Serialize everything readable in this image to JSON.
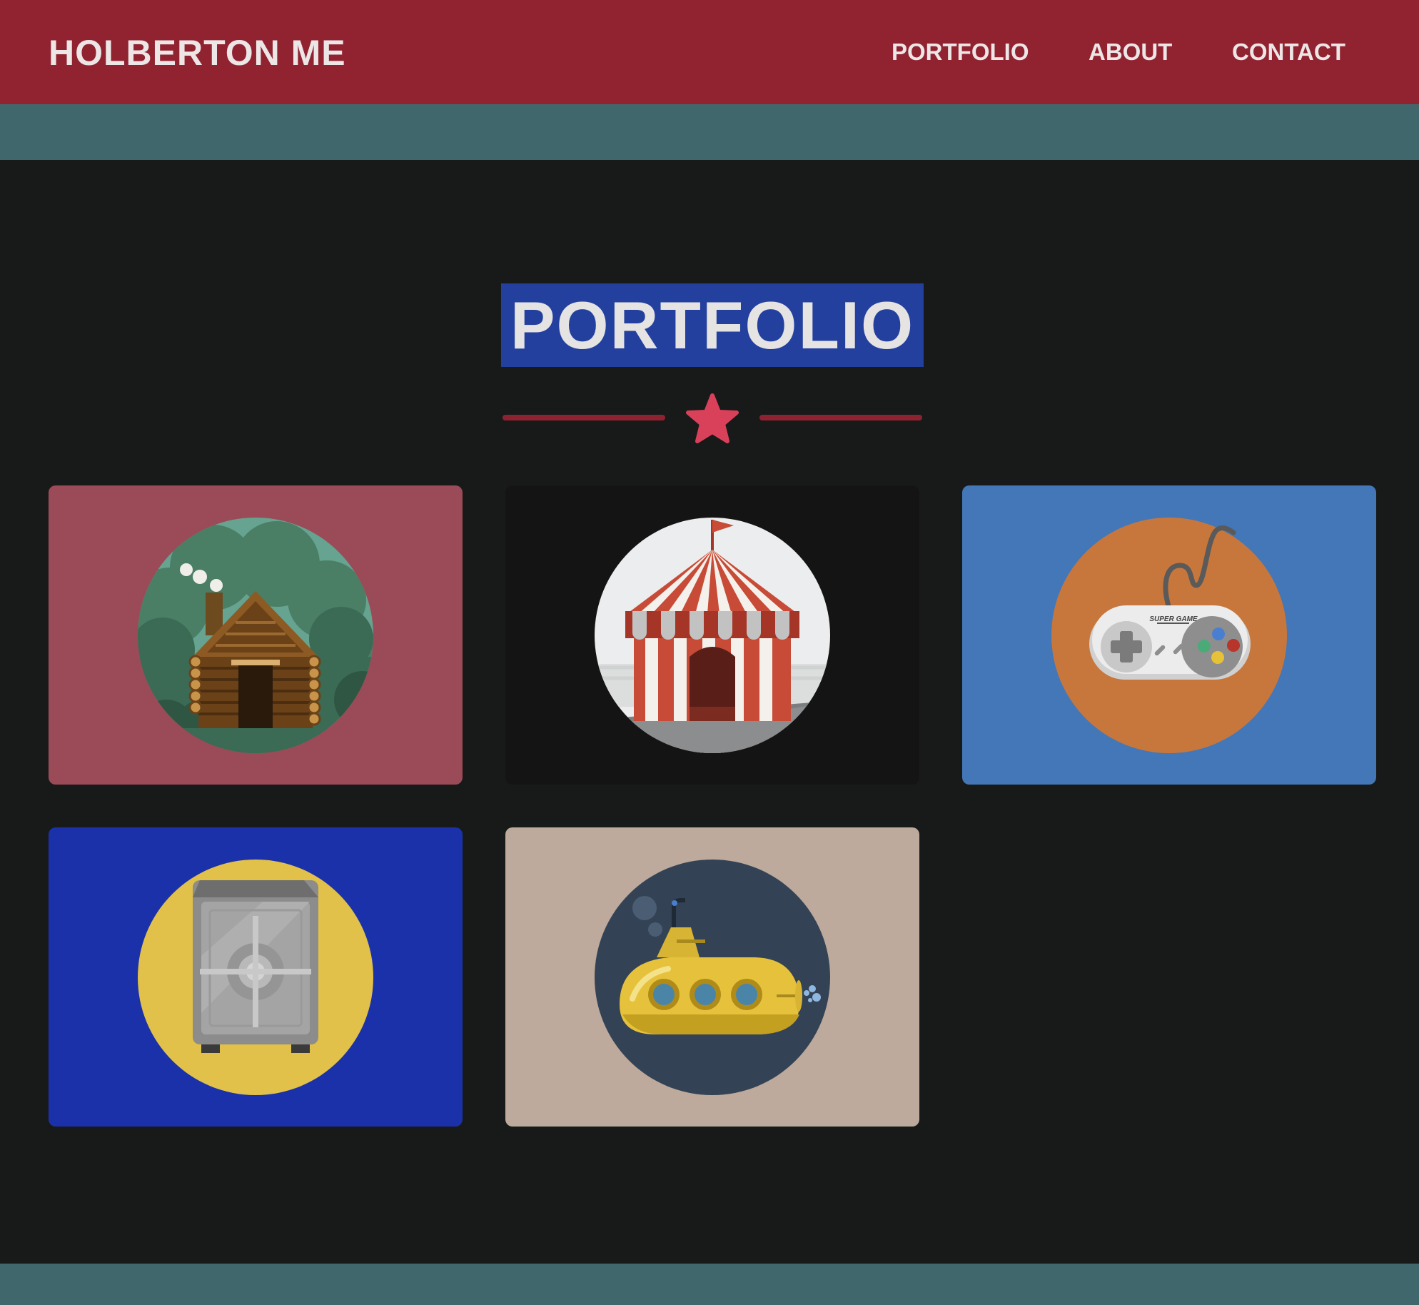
{
  "header": {
    "brand": "HOLBERTON ME",
    "nav": [
      {
        "label": "PORTFOLIO"
      },
      {
        "label": "ABOUT"
      },
      {
        "label": "CONTACT"
      }
    ],
    "background": "#912230"
  },
  "section": {
    "title": "PORTFOLIO",
    "title_highlight": "#23409e",
    "divider_icon": "star-icon",
    "accent": "#d9415a"
  },
  "portfolio": {
    "items": [
      {
        "icon": "log-cabin-icon",
        "background": "#9b4b58",
        "circle": "#66a390"
      },
      {
        "icon": "circus-tent-icon",
        "background": "#141414",
        "circle": "#ecedee"
      },
      {
        "icon": "game-controller-icon",
        "background": "#4377b8",
        "circle": "#c8773c",
        "controller_text": "SUPER GAME"
      },
      {
        "icon": "safe-icon",
        "background": "#1b31aa",
        "circle": "#e1c149"
      },
      {
        "icon": "submarine-icon",
        "background": "#bdaa9c",
        "circle": "#334355"
      }
    ]
  },
  "colors": {
    "page_background": "#181a19",
    "band": "#40686c"
  }
}
